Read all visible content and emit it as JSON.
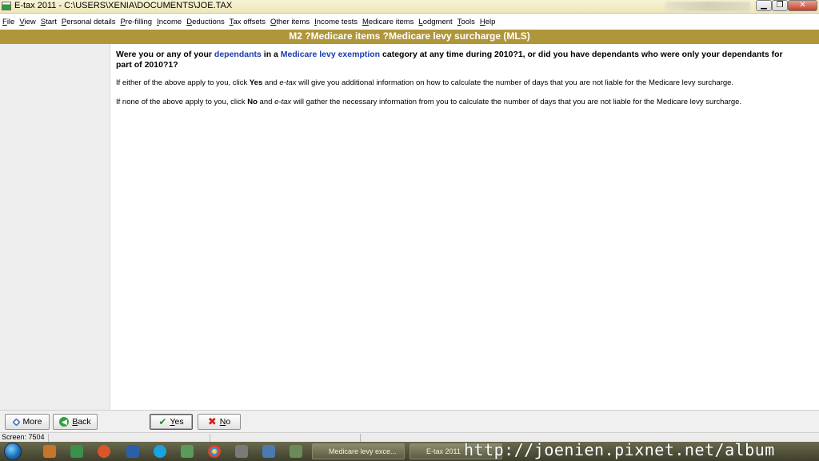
{
  "window": {
    "title": "E-tax 2011 - C:\\USERS\\XENIA\\DOCUMENTS\\JOE.TAX"
  },
  "menu": [
    "File",
    "View",
    "Start",
    "Personal details",
    "Pre-filling",
    "Income",
    "Deductions",
    "Tax offsets",
    "Other items",
    "Income tests",
    "Medicare items",
    "Lodgment",
    "Tools",
    "Help"
  ],
  "header": {
    "title": "M2 ?Medicare items ?Medicare levy surcharge (MLS)"
  },
  "question": {
    "part1": "Were you or any of your ",
    "link1": "dependants",
    "part2": " in a ",
    "link2": "Medicare levy exemption",
    "part3": " category at any time during 2010?1, or did you have dependants who were only your dependants for part of 2010?1?"
  },
  "info_yes": {
    "before": "If either of the above apply to you, click ",
    "bold": "Yes",
    "mid": " and ",
    "italic": "e-tax",
    "after": " will give you additional information on how to calculate the number of days that you are not liable for the Medicare levy surcharge."
  },
  "info_no": {
    "before": "If none of the above apply to you, click ",
    "bold": "No",
    "mid": " and ",
    "italic": "e-tax",
    "after": " will gather the necessary information from you to calculate the number of days that you are not liable for the Medicare levy surcharge."
  },
  "buttons": {
    "more": "More",
    "back": "Back",
    "yes": "Yes",
    "no": "No"
  },
  "status": {
    "screen": "Screen: 7504"
  },
  "taskbar": {
    "task1": "Medicare levy exce...",
    "task2": "E-tax 2011"
  },
  "watermark": "http://joenien.pixnet.net/album"
}
